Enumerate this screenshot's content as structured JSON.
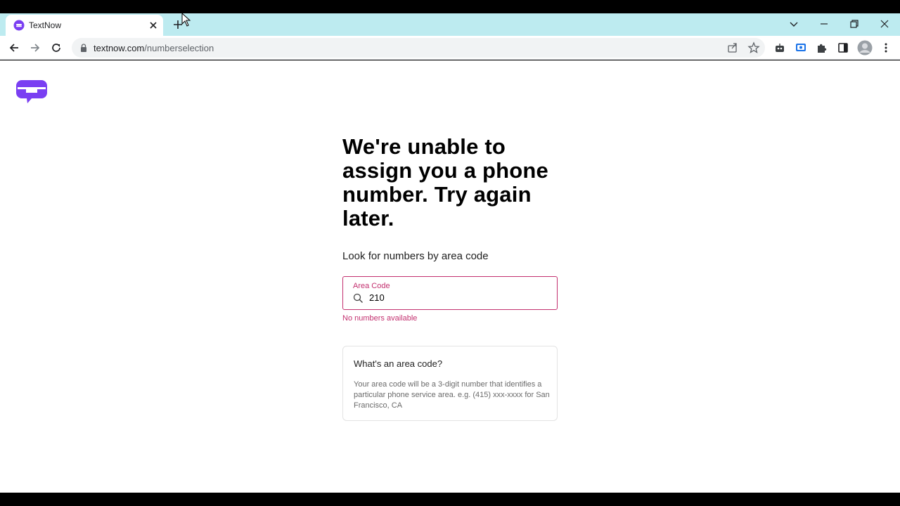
{
  "browser": {
    "tab": {
      "title": "TextNow",
      "favicon": "textnow-logo-icon"
    },
    "new_tab_icon": "plus-icon",
    "window_controls": [
      "chevron-down-icon",
      "minimize-icon",
      "restore-icon",
      "close-icon"
    ],
    "toolbar": {
      "url_host": "textnow.com",
      "url_path": "/numberselection",
      "icons": [
        "back-icon",
        "forward-icon",
        "reload-icon",
        "lock-icon",
        "share-icon",
        "star-icon",
        "robot-extension-icon",
        "screen-capture-icon",
        "puzzle-icon",
        "side-panel-icon",
        "avatar",
        "menu-icon"
      ]
    }
  },
  "page": {
    "headline": "We're unable to assign you a phone number. Try again later.",
    "subtext": "Look for numbers by area code",
    "area_code": {
      "label": "Area Code",
      "value": "210"
    },
    "error": "No numbers available",
    "info": {
      "title": "What's an area code?",
      "body": "Your area code will be a 3-digit number that identifies a particular phone service area. e.g. (415) xxx-xxxx for San Francisco, CA"
    }
  },
  "colors": {
    "tabstrip": "#bdebf0",
    "brand_purple": "#7a3ff2",
    "error_accent": "#c3306f"
  }
}
